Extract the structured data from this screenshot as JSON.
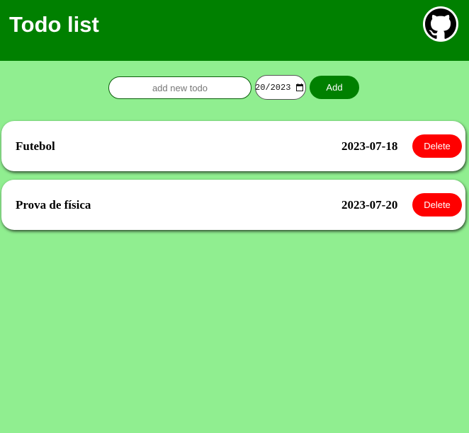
{
  "header": {
    "title": "Todo list",
    "github_icon": "github-icon"
  },
  "form": {
    "new_todo_placeholder": "add new todo",
    "new_todo_value": "",
    "date_display": "20/2023",
    "calendar_icon": "calendar-icon",
    "add_label": "Add"
  },
  "todos": [
    {
      "title": "Futebol",
      "date": "2023-07-18",
      "delete_label": "Delete"
    },
    {
      "title": "Prova de física",
      "date": "2023-07-20",
      "delete_label": "Delete"
    }
  ],
  "colors": {
    "header": "#008000",
    "background": "#90ee90",
    "add_button": "#008000",
    "delete_button": "#ff0000"
  }
}
